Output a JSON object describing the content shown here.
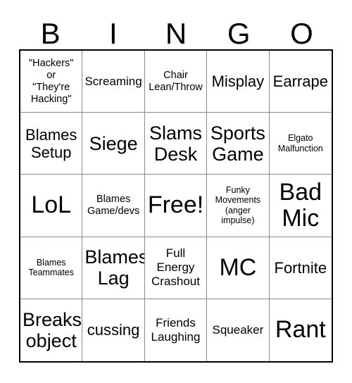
{
  "card": {
    "header_letters": [
      "B",
      "I",
      "N",
      "G",
      "O"
    ],
    "grid": {
      "rows": 5,
      "columns": 5,
      "border_color": "#000000",
      "divider_color": "#8a8a8a",
      "background_color": "#ffffff",
      "text_color": "#000000"
    },
    "cells": [
      {
        "text": "\"Hackers\"\nor\n\"They're\nHacking\"",
        "size": "sm"
      },
      {
        "text": "Screaming",
        "size": "md"
      },
      {
        "text": "Chair\nLean/Throw",
        "size": "sm"
      },
      {
        "text": "Misplay",
        "size": "lg"
      },
      {
        "text": "Earrape",
        "size": "lg"
      },
      {
        "text": "Blames\nSetup",
        "size": "lg"
      },
      {
        "text": "Siege",
        "size": "xl"
      },
      {
        "text": "Slams\nDesk",
        "size": "xl"
      },
      {
        "text": "Sports\nGame",
        "size": "xl"
      },
      {
        "text": "Elgato\nMalfunction",
        "size": "xs"
      },
      {
        "text": "LoL",
        "size": "xxl"
      },
      {
        "text": "Blames\nGame/devs",
        "size": "sm"
      },
      {
        "text": "Free!",
        "size": "xxl"
      },
      {
        "text": "Funky\nMovements\n(anger\nimpulse)",
        "size": "xs"
      },
      {
        "text": "Bad\nMic",
        "size": "xxl"
      },
      {
        "text": "Blames\nTeammates",
        "size": "xs"
      },
      {
        "text": "Blames\nLag",
        "size": "xl"
      },
      {
        "text": "Full\nEnergy\nCrashout",
        "size": "md"
      },
      {
        "text": "MC",
        "size": "xxl"
      },
      {
        "text": "Fortnite",
        "size": "lg"
      },
      {
        "text": "Breaks\nobject",
        "size": "xl"
      },
      {
        "text": "cussing",
        "size": "lg"
      },
      {
        "text": "Friends\nLaughing",
        "size": "md"
      },
      {
        "text": "Squeaker",
        "size": "md"
      },
      {
        "text": "Rant",
        "size": "xxl"
      }
    ]
  }
}
